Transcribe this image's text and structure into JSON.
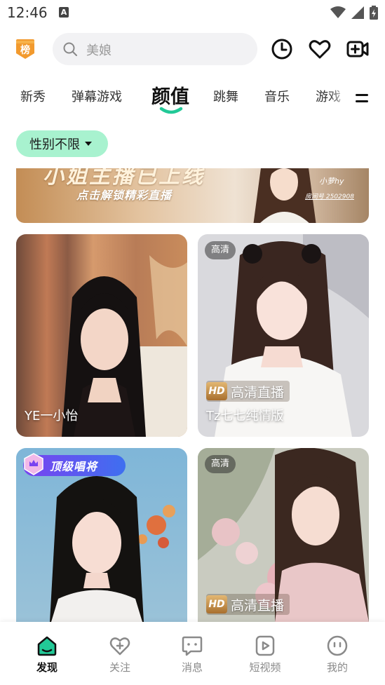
{
  "status_bar": {
    "time": "12:46",
    "notification_letter": "A"
  },
  "header": {
    "rank_badge_text": "榜",
    "search_placeholder": "美娘"
  },
  "tabs": [
    {
      "label": "新秀",
      "active": false
    },
    {
      "label": "弹幕游戏",
      "active": false
    },
    {
      "label": "颜值",
      "active": true
    },
    {
      "label": "跳舞",
      "active": false
    },
    {
      "label": "音乐",
      "active": false
    },
    {
      "label": "游戏",
      "active": false
    }
  ],
  "filter": {
    "label": "性别不限"
  },
  "banner": {
    "title": "小姐主播已上线",
    "subtitle": "点击解锁精彩直播",
    "name": "小萝hy",
    "room": "房间号 2502908"
  },
  "cards": [
    {
      "caption": "YE一小怡",
      "badge": "",
      "hd_live": "",
      "top_badge": ""
    },
    {
      "caption": "Tz七七纯情版",
      "badge": "高清",
      "hd_live": "高清直播",
      "hd_tag": "HD",
      "top_badge": ""
    },
    {
      "caption": "",
      "badge": "",
      "hd_live": "",
      "top_badge": "顶级唱将"
    },
    {
      "caption": "",
      "badge": "高清",
      "hd_live": "高清直播",
      "hd_tag": "HD",
      "top_badge": ""
    }
  ],
  "nav": [
    {
      "label": "发现",
      "icon": "home-icon",
      "active": true
    },
    {
      "label": "关注",
      "icon": "heart-plus-icon",
      "active": false
    },
    {
      "label": "消息",
      "icon": "message-icon",
      "active": false
    },
    {
      "label": "短视频",
      "icon": "video-play-icon",
      "active": false
    },
    {
      "label": "我的",
      "icon": "profile-icon",
      "active": false
    }
  ],
  "colors": {
    "accent": "#22c997",
    "chip": "#a8f2cf",
    "rank_badge": "#f29a2e"
  }
}
